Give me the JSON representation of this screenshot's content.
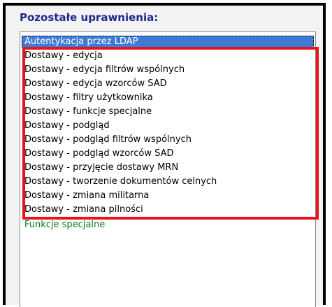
{
  "group": {
    "title": "Pozostałe uprawnienia:"
  },
  "list": {
    "selected": "Autentykacja przez LDAP",
    "items": [
      "Dostawy - edycja",
      "Dostawy - edycja filtrów wspólnych",
      "Dostawy - edycja wzorców SAD",
      "Dostawy - filtry użytkownika",
      "Dostawy - funkcje specjalne",
      "Dostawy - podgląd",
      "Dostawy - podgląd filtrów wspólnych",
      "Dostawy - podgląd wzorców SAD",
      "Dostawy - przyjęcie dostawy MRN",
      "Dostawy - tworzenie dokumentów celnych",
      "Dostawy - zmiana militarna",
      "Dostawy - zmiana pilności"
    ],
    "special": "Funkcje specjalne"
  },
  "colors": {
    "title": "#1c2a8c",
    "selection": "#3d7bd6",
    "special_item": "#0a7d16",
    "highlight_box": "#e8141c"
  }
}
